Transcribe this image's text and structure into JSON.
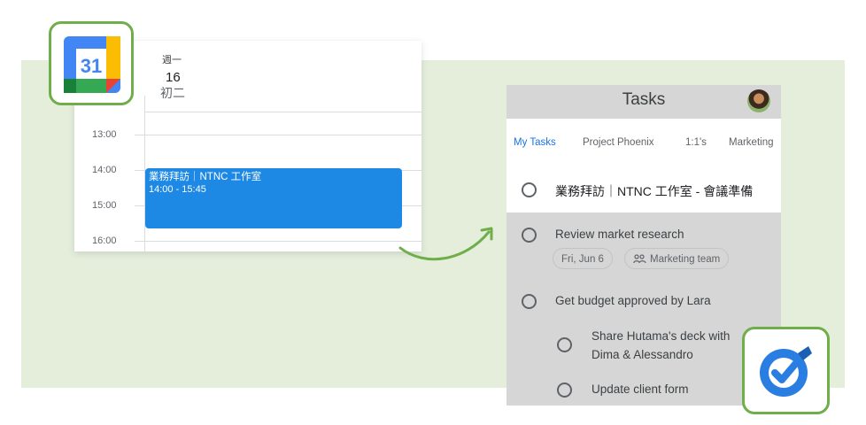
{
  "calendar": {
    "day_of_week": "週一",
    "day_number": "16",
    "lunar_date": "初二",
    "times": [
      "13:00",
      "14:00",
      "15:00",
      "16:00"
    ],
    "event": {
      "title": "業務拜訪｜NTNC 工作室",
      "time": "14:00 - 15:45",
      "color": "#1e88e5"
    },
    "logo_text": "31"
  },
  "tasks": {
    "title": "Tasks",
    "tabs": [
      {
        "label": "My Tasks",
        "active": true
      },
      {
        "label": "Project Phoenix"
      },
      {
        "label": "1:1's"
      },
      {
        "label": "Marketing"
      }
    ],
    "items": [
      {
        "text": "業務拜訪｜NTNC 工作室 - 會議準備"
      },
      {
        "text": "Review market research",
        "chips": [
          "Fri, Jun 6",
          "Marketing team"
        ]
      },
      {
        "text": "Get budget approved by Lara"
      },
      {
        "text_line1": "Share Hutama's deck with",
        "text_line2": "Dima & Alessandro"
      },
      {
        "text": "Update client form"
      }
    ]
  },
  "colors": {
    "accent_green": "#6fae4a",
    "background_band": "#e4eedb",
    "active_tab": "#1a73e8"
  },
  "icons": [
    "calendar-icon",
    "tasks-icon",
    "arrow-icon",
    "group-icon",
    "avatar"
  ]
}
